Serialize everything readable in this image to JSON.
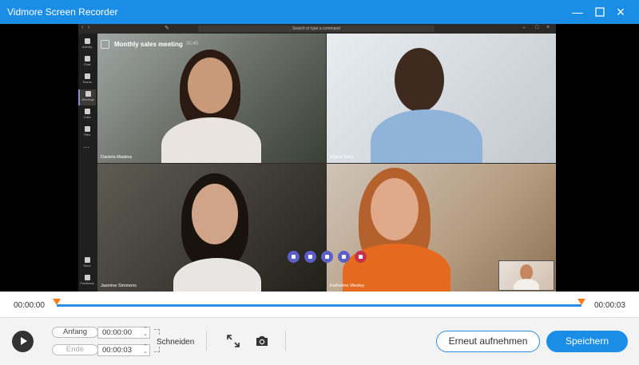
{
  "window": {
    "title": "Vidmore Screen Recorder",
    "minimize_icon": "minimize-icon",
    "maximize_icon": "maximize-icon",
    "close_icon": "close-icon"
  },
  "preview": {
    "teams": {
      "search_placeholder": "Search or type a command",
      "rail": [
        "Activity",
        "Chat",
        "Teams",
        "Meetings",
        "Calls",
        "Files"
      ],
      "rail_bottom": [
        "Store",
        "Feedback"
      ],
      "meeting_title": "Monthly sales meeting",
      "meeting_time": "35:45",
      "participants": [
        "Daniela Madera",
        "Miguel Silva",
        "Jasmine Simmons",
        "Katherine Wesley"
      ]
    }
  },
  "timeline": {
    "start_time": "00:00:00",
    "end_time": "00:00:03",
    "accent": "#2a8de3",
    "marker_color": "#ff7a1a"
  },
  "controls": {
    "start_label": "Anfang",
    "start_value": "00:00:00",
    "end_label": "Ende",
    "end_value": "00:00:03",
    "cut_label": "Schneiden",
    "redo_label": "Erneut aufnehmen",
    "save_label": "Speichern",
    "primary_color": "#1a8ee6"
  }
}
